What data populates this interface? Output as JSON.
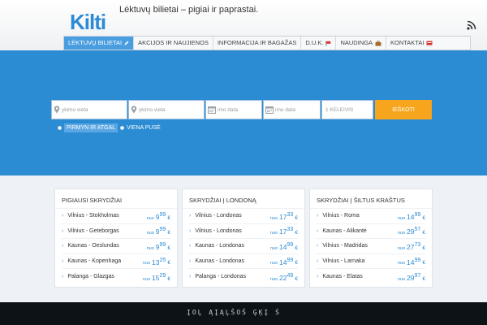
{
  "header": {
    "logo": "Kilti",
    "tagline": "Lėktuvų bilietai – pigiai ir paprastai."
  },
  "nav": [
    {
      "label": "LĖKTUVŲ BILIETAI",
      "active": true,
      "icon": "pencil-icon"
    },
    {
      "label": "AKCIJOS IR NAUJIENOS",
      "active": false,
      "icon": ""
    },
    {
      "label": "INFORMACIJA IR BAGAŽAS",
      "active": false,
      "icon": ""
    },
    {
      "label": "D.U.K.",
      "active": false,
      "icon": "flag-icon"
    },
    {
      "label": "NAUDINGA",
      "active": false,
      "icon": "briefcase-icon"
    },
    {
      "label": "KONTAKTAI",
      "active": false,
      "icon": "contact-icon"
    }
  ],
  "search": {
    "from_placeholder": "ykimo vieta",
    "to_placeholder": "ykimo vieta",
    "date1_placeholder": "imo data",
    "date2_placeholder": "imo data",
    "passengers": "1 KELEIVIS",
    "button": "IEŠKOTI",
    "trip_roundtrip": "PIRMYN IR ATGAL",
    "trip_oneway": "VIENA PUSĖ"
  },
  "cards": [
    {
      "title": "PIGIAUSI SKRYDŽIAI",
      "rows": [
        {
          "route": "Vilnius - Stokholmas",
          "nuo": "nuo",
          "price": "9",
          "cents": "99",
          "cur": "€"
        },
        {
          "route": "Vilnius - Geteborgas",
          "nuo": "nuo",
          "price": "9",
          "cents": "99",
          "cur": "€"
        },
        {
          "route": "Kaunas - Oeslundas",
          "nuo": "nuo",
          "price": "9",
          "cents": "99",
          "cur": "€"
        },
        {
          "route": "Kaunas - Kopenhaga",
          "nuo": "nuo",
          "price": "13",
          "cents": "25",
          "cur": "€"
        },
        {
          "route": "Palanga - Glazgas",
          "nuo": "nuo",
          "price": "15",
          "cents": "29",
          "cur": "€"
        }
      ]
    },
    {
      "title": "SKRYDŽIAI Į LONDONĄ",
      "rows": [
        {
          "route": "Vilnius - Londonas",
          "nuo": "nuo",
          "price": "17",
          "cents": "33",
          "cur": "€"
        },
        {
          "route": "Vilnius - Londonas",
          "nuo": "nuo",
          "price": "17",
          "cents": "33",
          "cur": "€"
        },
        {
          "route": "Kaunas - Londonas",
          "nuo": "nuo",
          "price": "14",
          "cents": "99",
          "cur": "€"
        },
        {
          "route": "Kaunas - Londonas",
          "nuo": "nuo",
          "price": "14",
          "cents": "99",
          "cur": "€"
        },
        {
          "route": "Palanga - Londonas",
          "nuo": "nuo",
          "price": "22",
          "cents": "49",
          "cur": "€"
        }
      ]
    },
    {
      "title": "SKRYDŽIAI Į ŠILTUS KRAŠTUS",
      "rows": [
        {
          "route": "Vilnius - Roma",
          "nuo": "nuo",
          "price": "14",
          "cents": "99",
          "cur": "€"
        },
        {
          "route": "Kaunas - Alikantė",
          "nuo": "nuo",
          "price": "29",
          "cents": "57",
          "cur": "€"
        },
        {
          "route": "Vilnius - Madridas",
          "nuo": "nuo",
          "price": "27",
          "cents": "73",
          "cur": "€"
        },
        {
          "route": "Vilnius - Larnaka",
          "nuo": "nuo",
          "price": "14",
          "cents": "99",
          "cur": "€"
        },
        {
          "route": "Kaunas - Elatas",
          "nuo": "nuo",
          "price": "29",
          "cents": "97",
          "cur": "€"
        }
      ]
    }
  ],
  "footer": {
    "text": "ĮOĻ ĄĮĄĻŠOŠ ĢĶĮ Ś"
  },
  "colors": {
    "accent": "#2b8bd3",
    "button": "#f7a51d",
    "footer": "#0d1217"
  }
}
